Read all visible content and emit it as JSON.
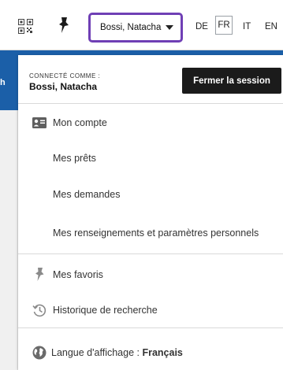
{
  "topbar": {
    "user_name": "Bossi, Natacha",
    "languages": [
      "DE",
      "FR",
      "IT",
      "EN"
    ],
    "active_language": "FR"
  },
  "background_text": "h",
  "account_menu": {
    "connected_label": "CONNECTÉ COMME :",
    "connected_user": "Bossi, Natacha",
    "logout_label": "Fermer la session",
    "items": [
      {
        "label": "Mon compte",
        "icon": "id-card-icon"
      },
      {
        "label": "Mes prêts"
      },
      {
        "label": "Mes demandes"
      },
      {
        "label": "Mes renseignements et paramètres personnels"
      }
    ],
    "favorites_label": "Mes favoris",
    "history_label": "Historique de recherche",
    "display_language_label": "Langue d'affichage : ",
    "display_language_value": "Français"
  },
  "colors": {
    "accent_purple": "#6f3fb5",
    "header_blue": "#1b5fa8",
    "button_dark": "#1b1b1b"
  }
}
